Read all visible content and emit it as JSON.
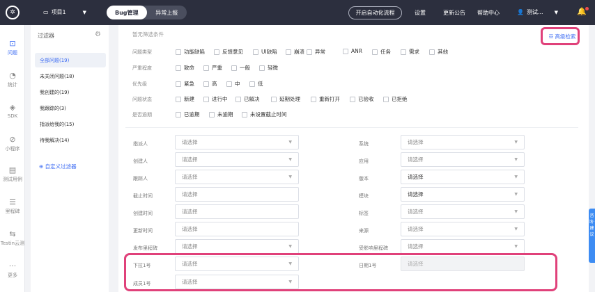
{
  "topbar": {
    "project": "项目1",
    "tabs": [
      "Bug管理",
      "异常上报"
    ],
    "auto_flow": "开启自动化流程",
    "nav": [
      "设置",
      "更新公告",
      "帮助中心"
    ],
    "user": "测试..."
  },
  "leftnav": {
    "items": [
      {
        "label": "问题",
        "icon": "issue-icon"
      },
      {
        "label": "统计",
        "icon": "stats-icon"
      },
      {
        "label": "SDK",
        "icon": "sdk-icon"
      },
      {
        "label": "小程序",
        "icon": "miniapp-icon"
      },
      {
        "label": "测试用例",
        "icon": "testcase-icon"
      },
      {
        "label": "里程碑",
        "icon": "milestone-icon"
      },
      {
        "label": "Testin云测",
        "icon": "cloud-icon"
      },
      {
        "label": "更多",
        "icon": "more-icon"
      }
    ]
  },
  "filters": {
    "title": "过滤器",
    "items": [
      "全部问题(19)",
      "未关闭问题(18)",
      "我创建的(19)",
      "我跟踪的(3)",
      "指派给我的(15)",
      "待我解决(14)"
    ],
    "custom": "⊕ 自定义过滤器"
  },
  "main": {
    "no_condition": "暂无筛选条件",
    "advanced_search": "高级检索",
    "rows": [
      {
        "label": "问题类型",
        "options": [
          "功能缺陷",
          "反馈意见",
          "UI缺陷",
          "崩溃",
          "异常",
          "ANR",
          "任务",
          "需求",
          "其他"
        ]
      },
      {
        "label": "严重程度",
        "options": [
          "致命",
          "严重",
          "一般",
          "轻微"
        ]
      },
      {
        "label": "优先级",
        "options": [
          "紧急",
          "高",
          "中",
          "低"
        ]
      },
      {
        "label": "问题状态",
        "options": [
          "新建",
          "进行中",
          "已解决",
          "延期处理",
          "重新打开",
          "已验收",
          "已拒绝"
        ]
      },
      {
        "label": "是否逾期",
        "options": [
          "已逾期",
          "未逾期",
          "未设置截止时间"
        ]
      }
    ],
    "fields_left": [
      {
        "label": "指派人",
        "placeholder": "请选择"
      },
      {
        "label": "创建人",
        "placeholder": "请选择"
      },
      {
        "label": "跟踪人",
        "placeholder": "请选择"
      },
      {
        "label": "截止时间",
        "placeholder": "请选择"
      },
      {
        "label": "创建时间",
        "placeholder": "请选择"
      },
      {
        "label": "更新时间",
        "placeholder": "请选择"
      },
      {
        "label": "发布里程碑",
        "placeholder": "请选择"
      },
      {
        "label": "下拉1号",
        "placeholder": "请选择"
      },
      {
        "label": "成员1号",
        "placeholder": "请选择"
      }
    ],
    "fields_right": [
      {
        "label": "系统",
        "placeholder": "请选择"
      },
      {
        "label": "应用",
        "placeholder": "请选择"
      },
      {
        "label": "版本",
        "placeholder": "请选择"
      },
      {
        "label": "模块",
        "placeholder": "请选择"
      },
      {
        "label": "标签",
        "placeholder": "请选择"
      },
      {
        "label": "来源",
        "placeholder": "请选择"
      },
      {
        "label": "受影响里程碑",
        "placeholder": "请选择"
      },
      {
        "label": "日期1号",
        "placeholder": "请选择"
      }
    ]
  },
  "edge_widget": "咨询·建议"
}
